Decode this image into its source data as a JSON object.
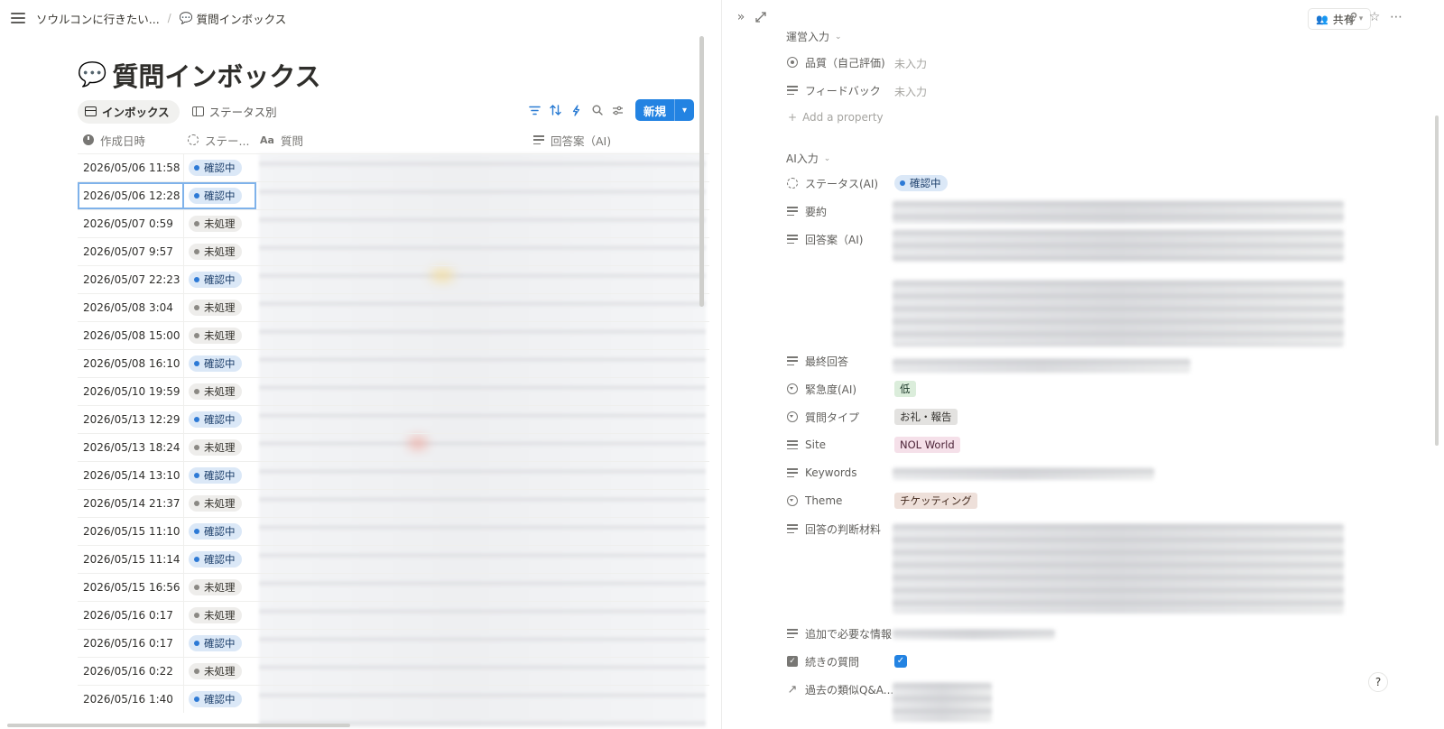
{
  "breadcrumb": {
    "workspace": "ソウルコンに行きたい...",
    "page": "質問インボックス",
    "separator": "/"
  },
  "page": {
    "emoji": "💬",
    "title": "質問インボックス"
  },
  "views": [
    {
      "label": "インボックス",
      "active": true
    },
    {
      "label": "ステータス別",
      "active": false
    }
  ],
  "toolbar": {
    "icons": [
      "filter-icon",
      "sort-icon",
      "automation-icon",
      "search-icon",
      "settings-icon"
    ],
    "new_label": "新規"
  },
  "table": {
    "columns": [
      "作成日時",
      "ステー...",
      "質問",
      "回答案（AI)"
    ],
    "rows": [
      {
        "date": "2026/05/06 11:58",
        "status": "確認中",
        "color": "blue"
      },
      {
        "date": "2026/05/06 12:28",
        "status": "確認中",
        "color": "blue",
        "selected": true
      },
      {
        "date": "2026/05/07 0:59",
        "status": "未処理",
        "color": "gray"
      },
      {
        "date": "2026/05/07 9:57",
        "status": "未処理",
        "color": "gray"
      },
      {
        "date": "2026/05/07 22:23",
        "status": "確認中",
        "color": "blue"
      },
      {
        "date": "2026/05/08 3:04",
        "status": "未処理",
        "color": "gray"
      },
      {
        "date": "2026/05/08 15:00",
        "status": "未処理",
        "color": "gray"
      },
      {
        "date": "2026/05/08 16:10",
        "status": "確認中",
        "color": "blue"
      },
      {
        "date": "2026/05/10 19:59",
        "status": "未処理",
        "color": "gray"
      },
      {
        "date": "2026/05/13 12:29",
        "status": "確認中",
        "color": "blue"
      },
      {
        "date": "2026/05/13 18:24",
        "status": "未処理",
        "color": "gray"
      },
      {
        "date": "2026/05/14 13:10",
        "status": "確認中",
        "color": "blue"
      },
      {
        "date": "2026/05/14 21:37",
        "status": "未処理",
        "color": "gray"
      },
      {
        "date": "2026/05/15 11:10",
        "status": "確認中",
        "color": "blue"
      },
      {
        "date": "2026/05/15 11:14",
        "status": "確認中",
        "color": "blue"
      },
      {
        "date": "2026/05/15 16:56",
        "status": "未処理",
        "color": "gray"
      },
      {
        "date": "2026/05/16 0:17",
        "status": "未処理",
        "color": "gray"
      },
      {
        "date": "2026/05/16 0:17",
        "status": "確認中",
        "color": "blue"
      },
      {
        "date": "2026/05/16 0:22",
        "status": "未処理",
        "color": "gray"
      },
      {
        "date": "2026/05/16 1:40",
        "status": "確認中",
        "color": "blue"
      }
    ]
  },
  "peek": {
    "share_label": "共有",
    "section_ops": "運営入力",
    "section_ai": "AI入力",
    "add_property": "Add a property",
    "props": {
      "quality": {
        "name": "品質（自己評価)",
        "value": "未入力"
      },
      "feedback": {
        "name": "フィードバック",
        "value": "未入力"
      },
      "status_ai": {
        "name": "ステータス(AI)",
        "value": "確認中"
      },
      "summary": {
        "name": "要約"
      },
      "answer_ai": {
        "name": "回答案（AI)"
      },
      "final_answer": {
        "name": "最終回答"
      },
      "urgency": {
        "name": "緊急度(AI)",
        "value": "低"
      },
      "question_type": {
        "name": "質問タイプ",
        "value": "お礼・報告"
      },
      "site": {
        "name": "Site",
        "value": "NOL World"
      },
      "keywords": {
        "name": "Keywords"
      },
      "theme": {
        "name": "Theme",
        "value": "チケッティング"
      },
      "basis": {
        "name": "回答の判断材料"
      },
      "extra_info": {
        "name": "追加で必要な情報"
      },
      "followup": {
        "name": "続きの質問",
        "checked": true
      },
      "past_qa": {
        "name": "過去の類似Q&A..."
      }
    },
    "help": "?"
  },
  "colors": {
    "accent": "#2383e2",
    "blue_pill": "#dbe8f7",
    "gray_pill": "#eeedeb"
  }
}
